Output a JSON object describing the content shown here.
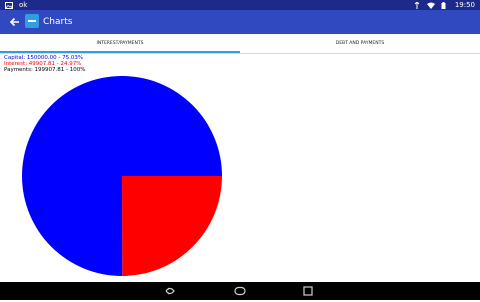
{
  "status_bar": {
    "icons_left": [
      "photo-icon",
      "ok-icon"
    ],
    "time": "19:50",
    "ok": "ok"
  },
  "app_bar": {
    "title": "Charts",
    "back_icon": "arrow-back-icon",
    "app_icon": "app-icon"
  },
  "tabs": [
    {
      "label": "INTEREST/PAYMENTS",
      "selected": true
    },
    {
      "label": "DEBT AND PAYMENTS",
      "selected": false
    }
  ],
  "legend": {
    "capital": "Capital:  150000.00 - 75.03%",
    "interest": "Interest:  49907.81 - 24.97%",
    "payments": "Payments:  199907.81 - 100%"
  },
  "colors": {
    "capital": "#0000ff",
    "interest": "#ff0000",
    "accent": "#2f9de0",
    "appbar": "#3048c0"
  },
  "chart_data": {
    "type": "pie",
    "categories": [
      "Capital",
      "Interest"
    ],
    "values": [
      150000.0,
      49907.81
    ],
    "percentages": [
      75.03,
      24.97
    ],
    "total": 199907.81,
    "colors": [
      "#0000ff",
      "#ff0000"
    ]
  },
  "nav_bar": {
    "back": "back-icon",
    "home": "home-icon",
    "recents": "recents-icon"
  }
}
